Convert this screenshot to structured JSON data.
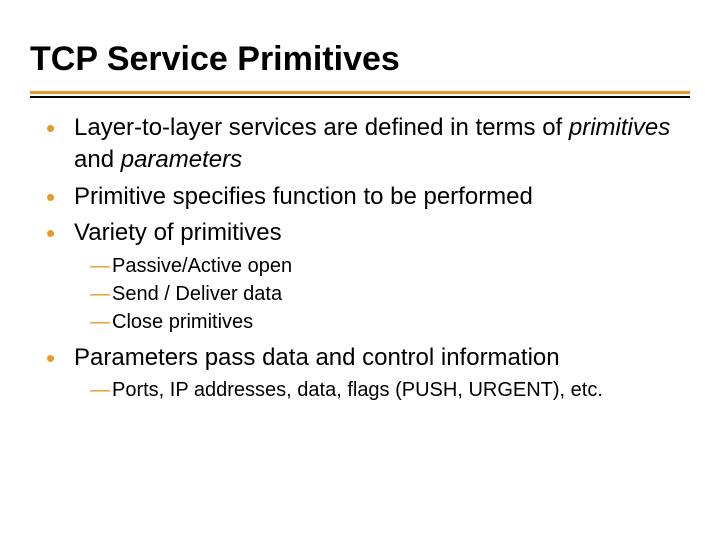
{
  "title": "TCP Service Primitives",
  "bullets": {
    "b1_pre": "Layer-to-layer services are defined in terms of ",
    "b1_ital1": "primitives",
    "b1_mid": " and ",
    "b1_ital2": "parameters",
    "b2": "Primitive specifies function to be performed",
    "b3": "Variety of primitives",
    "b3_sub": {
      "s1": "Passive/Active open",
      "s2": "Send / Deliver data",
      "s3": "Close primitives"
    },
    "b4": "Parameters pass data and control information",
    "b4_sub": {
      "s1": "Ports, IP addresses, data, flags (PUSH, URGENT), etc."
    }
  }
}
